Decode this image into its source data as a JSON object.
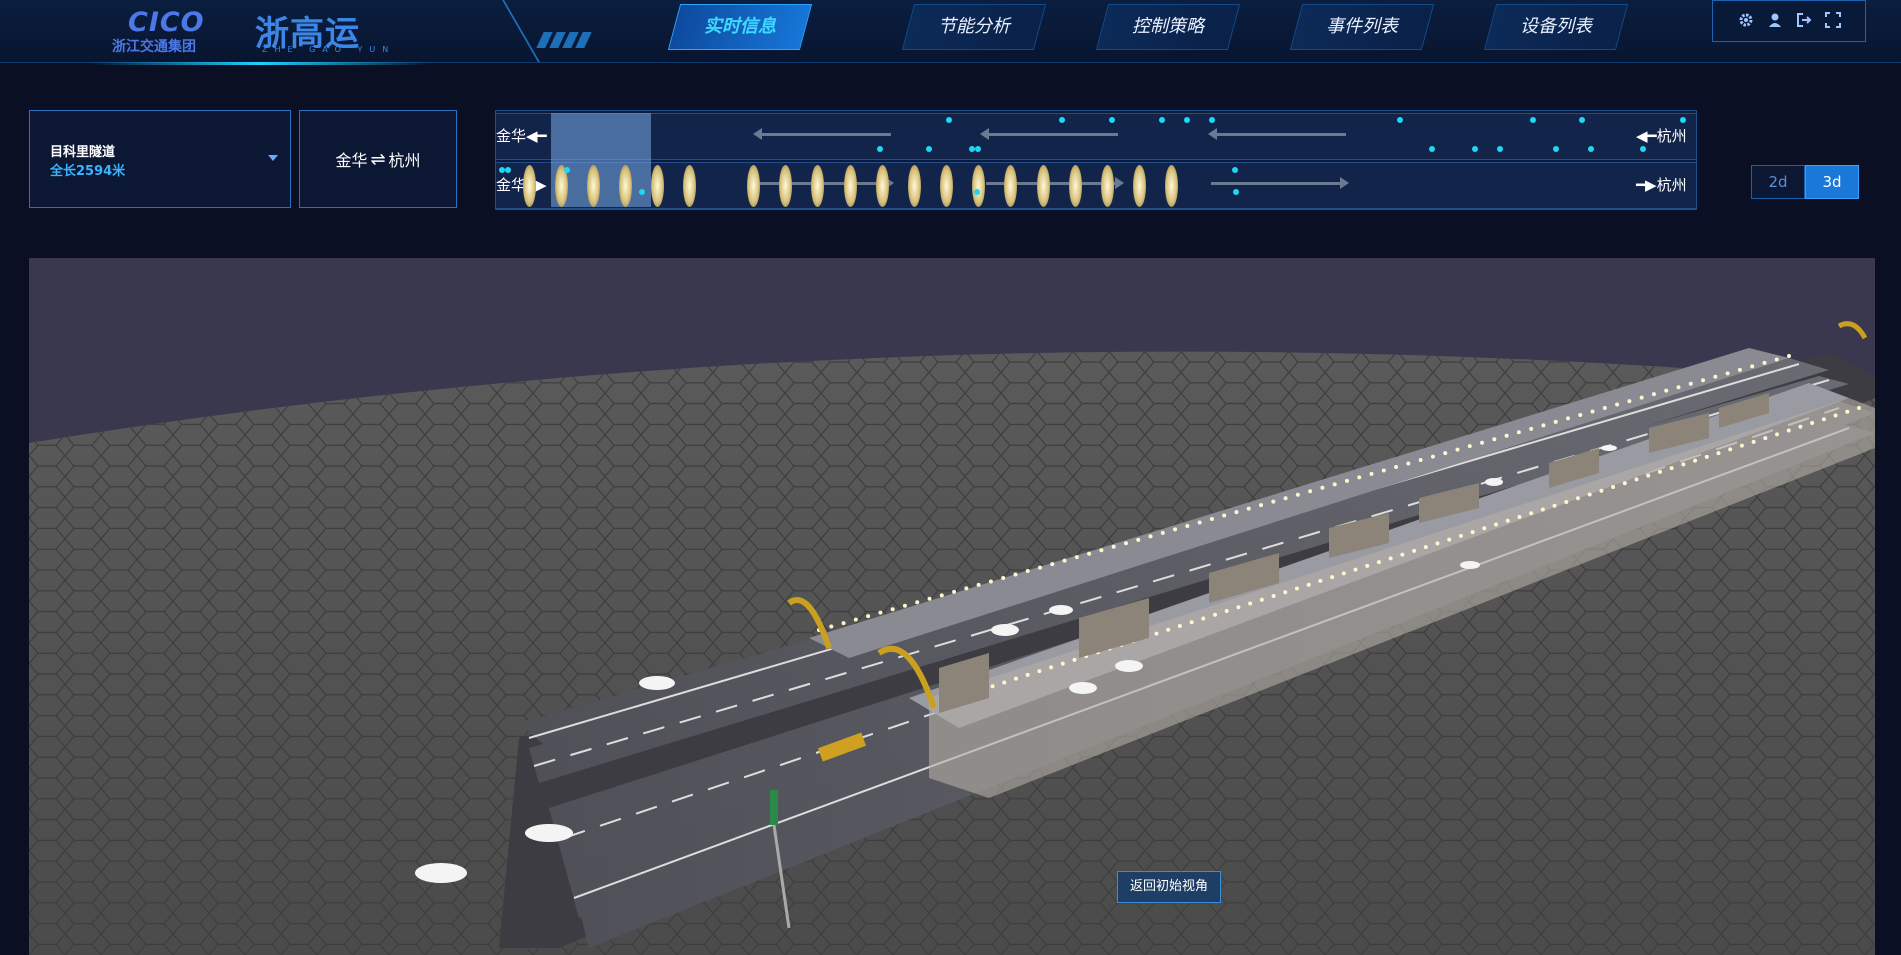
{
  "header": {
    "logo_cico": "CICO",
    "logo_cico_sub": "浙江交通集团",
    "logo_brand": "浙高运",
    "logo_brand_sub": "ZHE GAO YUN",
    "nav": [
      {
        "label": "实时信息",
        "active": true
      },
      {
        "label": "节能分析",
        "active": false
      },
      {
        "label": "控制策略",
        "active": false
      },
      {
        "label": "事件列表",
        "active": false
      },
      {
        "label": "设备列表",
        "active": false
      }
    ],
    "tools": [
      "gear-icon",
      "user-icon",
      "logout-icon",
      "fullscreen-icon"
    ]
  },
  "tunnel": {
    "name": "目科里隧道",
    "length": "全长2594米"
  },
  "direction": {
    "from": "金华",
    "to": "杭州"
  },
  "lanes": {
    "top_left": "金华",
    "top_right": "杭州",
    "bottom_left": "金华",
    "bottom_right": "杭州"
  },
  "view_toggle": {
    "options": [
      "2d",
      "3d"
    ],
    "selected": "3d"
  },
  "scene": {
    "reset_button": "返回初始视角"
  },
  "colors": {
    "accent": "#1fd7f2",
    "active_nav": "#3fd8ff",
    "panel_border": "#2a6fc0",
    "background": "#0a0f24"
  }
}
